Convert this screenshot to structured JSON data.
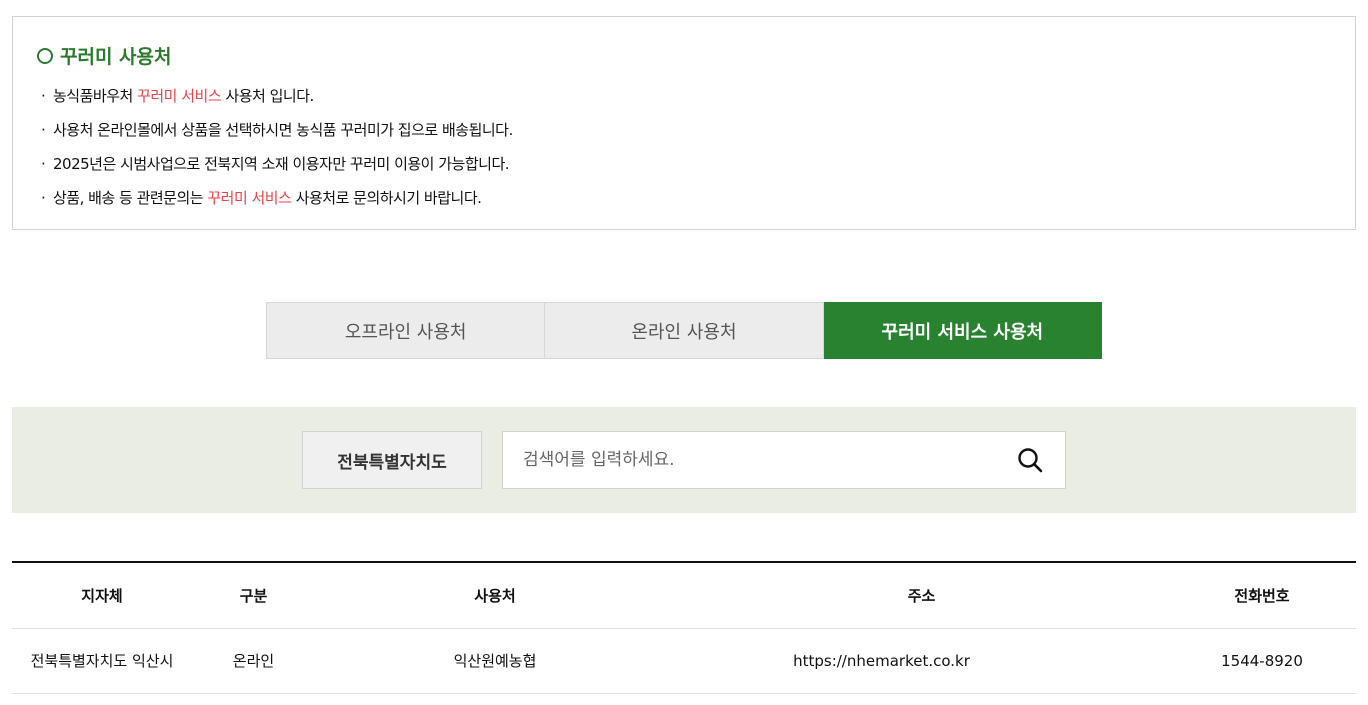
{
  "notice": {
    "title": "꾸러미 사용처",
    "items": [
      {
        "before": "농식품바우처 ",
        "highlight": "꾸러미 서비스",
        "after": " 사용처 입니다."
      },
      {
        "before": "사용처 온라인몰에서 상품을 선택하시면 농식품 꾸러미가 집으로 배송됩니다.",
        "highlight": "",
        "after": ""
      },
      {
        "before": "2025년은 시범사업으로 전북지역 소재 이용자만 꾸러미 이용이 가능합니다.",
        "highlight": "",
        "after": ""
      },
      {
        "before": "상품, 배송 등 관련문의는 ",
        "highlight": "꾸러미 서비스",
        "after": " 사용처로 문의하시기 바랍니다."
      }
    ]
  },
  "tabs": [
    {
      "label": "오프라인 사용처",
      "active": false
    },
    {
      "label": "온라인 사용처",
      "active": false
    },
    {
      "label": "꾸러미 서비스 사용처",
      "active": true
    }
  ],
  "search": {
    "region": "전북특별자치도",
    "placeholder": "검색어를 입력하세요.",
    "button_icon": "search-icon"
  },
  "table": {
    "headers": [
      "지자체",
      "구분",
      "사용처",
      "주소",
      "전화번호"
    ],
    "rows": [
      [
        "전북특별자치도 익산시",
        "온라인",
        "익산원예농협",
        "https://nhemarket.co.kr",
        "1544-8920"
      ]
    ]
  },
  "colors": {
    "accent_green": "#288230",
    "highlight_red": "#e8434b",
    "search_bg": "#e9ede4"
  }
}
